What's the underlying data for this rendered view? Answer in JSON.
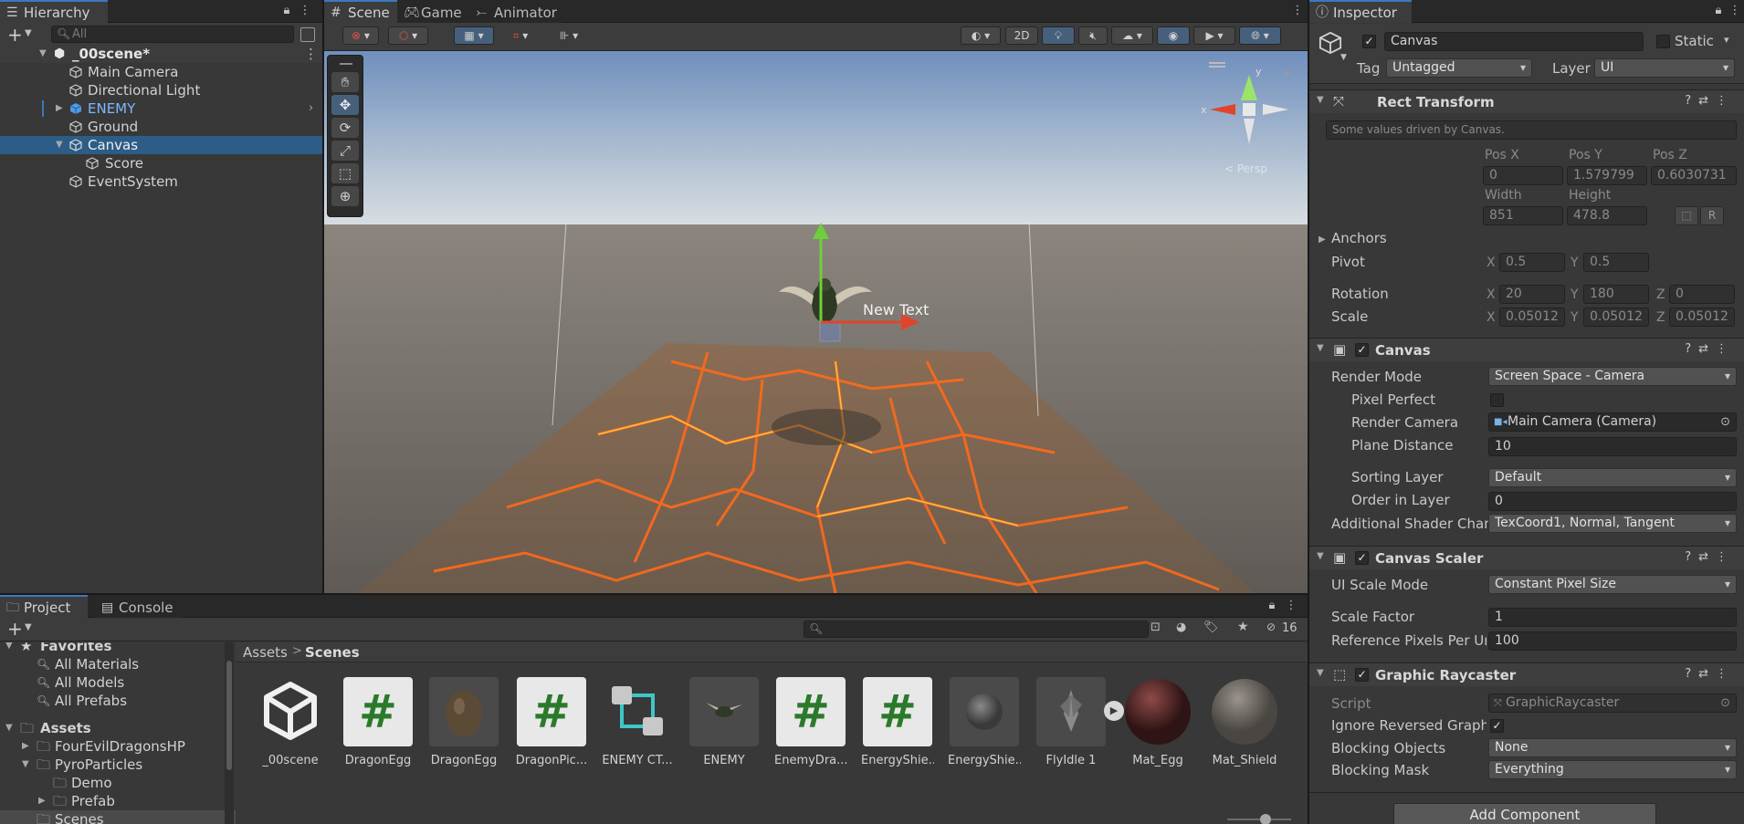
{
  "hierarchy": {
    "tab_label": "Hierarchy",
    "search_placeholder": "All",
    "scene_name": "_00scene*",
    "items": [
      {
        "label": "Main Camera"
      },
      {
        "label": "Directional Light"
      },
      {
        "label": "ENEMY"
      },
      {
        "label": "Ground"
      },
      {
        "label": "Canvas"
      },
      {
        "label": "Score"
      },
      {
        "label": "EventSystem"
      }
    ]
  },
  "scene_tabs": {
    "scene": "Scene",
    "game": "Game",
    "animator": "Animator"
  },
  "scene_toolbar": {
    "mode_2d": "2D"
  },
  "scene_view": {
    "new_text": "New Text",
    "gizmo": {
      "x": "x",
      "y": "y",
      "persp": "< Persp"
    }
  },
  "inspector": {
    "tab_label": "Inspector",
    "object_name": "Canvas",
    "static_label": "Static",
    "tag_label": "Tag",
    "tag_value": "Untagged",
    "layer_label": "Layer",
    "layer_value": "UI",
    "rect_transform": {
      "title": "Rect Transform",
      "note": "Some values driven by Canvas.",
      "pos_x_label": "Pos X",
      "pos_y_label": "Pos Y",
      "pos_z_label": "Pos Z",
      "pos_x": "0",
      "pos_y": "1.579799",
      "pos_z": "0.6030731",
      "width_label": "Width",
      "height_label": "Height",
      "width": "851",
      "height": "478.8",
      "r_label": "R",
      "anchors_label": "Anchors",
      "pivot_label": "Pivot",
      "pivot_x": "0.5",
      "pivot_y": "0.5",
      "rotation_label": "Rotation",
      "rot_x": "20",
      "rot_y": "180",
      "rot_z": "0",
      "scale_label": "Scale",
      "scale_x": "0.05012",
      "scale_y": "0.05012",
      "scale_z": "0.05012",
      "x": "X",
      "y": "Y",
      "z": "Z"
    },
    "canvas": {
      "title": "Canvas",
      "render_mode_label": "Render Mode",
      "render_mode": "Screen Space - Camera",
      "pixel_perfect_label": "Pixel Perfect",
      "render_camera_label": "Render Camera",
      "render_camera": "Main Camera (Camera)",
      "plane_distance_label": "Plane Distance",
      "plane_distance": "10",
      "sorting_layer_label": "Sorting Layer",
      "sorting_layer": "Default",
      "order_in_layer_label": "Order in Layer",
      "order_in_layer": "0",
      "shader_channels_label": "Additional Shader Chan",
      "shader_channels": "TexCoord1, Normal, Tangent"
    },
    "canvas_scaler": {
      "title": "Canvas Scaler",
      "ui_scale_mode_label": "UI Scale Mode",
      "ui_scale_mode": "Constant Pixel Size",
      "scale_factor_label": "Scale Factor",
      "scale_factor": "1",
      "ref_ppu_label": "Reference Pixels Per Ur",
      "ref_ppu": "100"
    },
    "graphic_raycaster": {
      "title": "Graphic Raycaster",
      "script_label": "Script",
      "script": "GraphicRaycaster",
      "ignore_reversed_label": "Ignore Reversed Graphi",
      "blocking_objects_label": "Blocking Objects",
      "blocking_objects": "None",
      "blocking_mask_label": "Blocking Mask",
      "blocking_mask": "Everything"
    },
    "add_component": "Add Component"
  },
  "project": {
    "tab_project": "Project",
    "tab_console": "Console",
    "hidden_count": "16",
    "breadcrumb_root": "Assets",
    "breadcrumb_sep": ">",
    "breadcrumb_current": "Scenes",
    "favorites_label": "Favorites",
    "favorites": [
      "All Materials",
      "All Models",
      "All Prefabs"
    ],
    "assets_label": "Assets",
    "folders": [
      "FourEvilDragonsHP",
      "PyroParticles",
      "Demo",
      "Prefab",
      "Scenes"
    ],
    "asset_items": [
      {
        "name": "_00scene",
        "icon": "unity-scene-icon"
      },
      {
        "name": "DragonEgg",
        "icon": "csharp-script-icon"
      },
      {
        "name": "DragonEgg",
        "icon": "egg-model-icon"
      },
      {
        "name": "DragonPic...",
        "icon": "csharp-script-icon"
      },
      {
        "name": "ENEMY CT...",
        "icon": "animator-controller-icon"
      },
      {
        "name": "ENEMY",
        "icon": "dragon-prefab-icon"
      },
      {
        "name": "EnemyDra...",
        "icon": "csharp-script-icon"
      },
      {
        "name": "EnergyShie...",
        "icon": "csharp-script-icon"
      },
      {
        "name": "EnergyShie...",
        "icon": "sphere-material-icon"
      },
      {
        "name": "FlyIdle 1",
        "icon": "animation-clip-icon"
      },
      {
        "name": "Mat_Egg",
        "icon": "material-sphere-icon"
      },
      {
        "name": "Mat_Shield",
        "icon": "material-sphere-icon"
      }
    ]
  },
  "colors": {
    "accent": "#3a79bb",
    "selection": "#2c5d87",
    "panel": "#383838",
    "enemy_prefab": "#7cb7ff"
  }
}
